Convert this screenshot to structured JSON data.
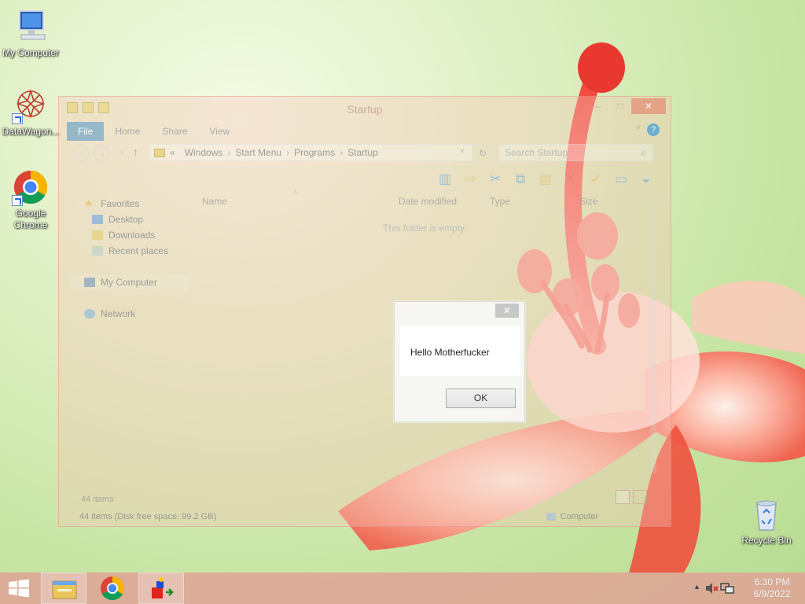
{
  "desktop": {
    "icons": [
      {
        "label": "My Computer"
      },
      {
        "label": "DataWagon..."
      },
      {
        "label": "Google Chrome"
      },
      {
        "label": "Recycle Bin"
      }
    ]
  },
  "explorer": {
    "title": "Startup",
    "ribbon_tabs": [
      "File",
      "Home",
      "Share",
      "View"
    ],
    "address": {
      "prefix": "«",
      "crumbs": [
        "Windows",
        "Start Menu",
        "Programs",
        "Startup"
      ]
    },
    "search_placeholder": "Search Startup",
    "nav": {
      "favorites": "Favorites",
      "desktop": "Desktop",
      "downloads": "Downloads",
      "recent": "Recent places",
      "my_computer": "My Computer",
      "network": "Network"
    },
    "columns": [
      "Name",
      "Date modified",
      "Type",
      "Size"
    ],
    "empty_message": "This folder is empty.",
    "item_count": "44 items",
    "status_left": "44 items (Disk free space: 99.2 GB)",
    "status_right": "Computer"
  },
  "message_box": {
    "text": "Hello Motherfucker",
    "ok_label": "OK",
    "close_glyph": "✕"
  },
  "taskbar": {
    "time": "6:30 PM",
    "date": "6/9/2022"
  },
  "colors": {
    "taskbar": "#dea596",
    "accent": "#5596c8",
    "close": "#e86e5a"
  }
}
